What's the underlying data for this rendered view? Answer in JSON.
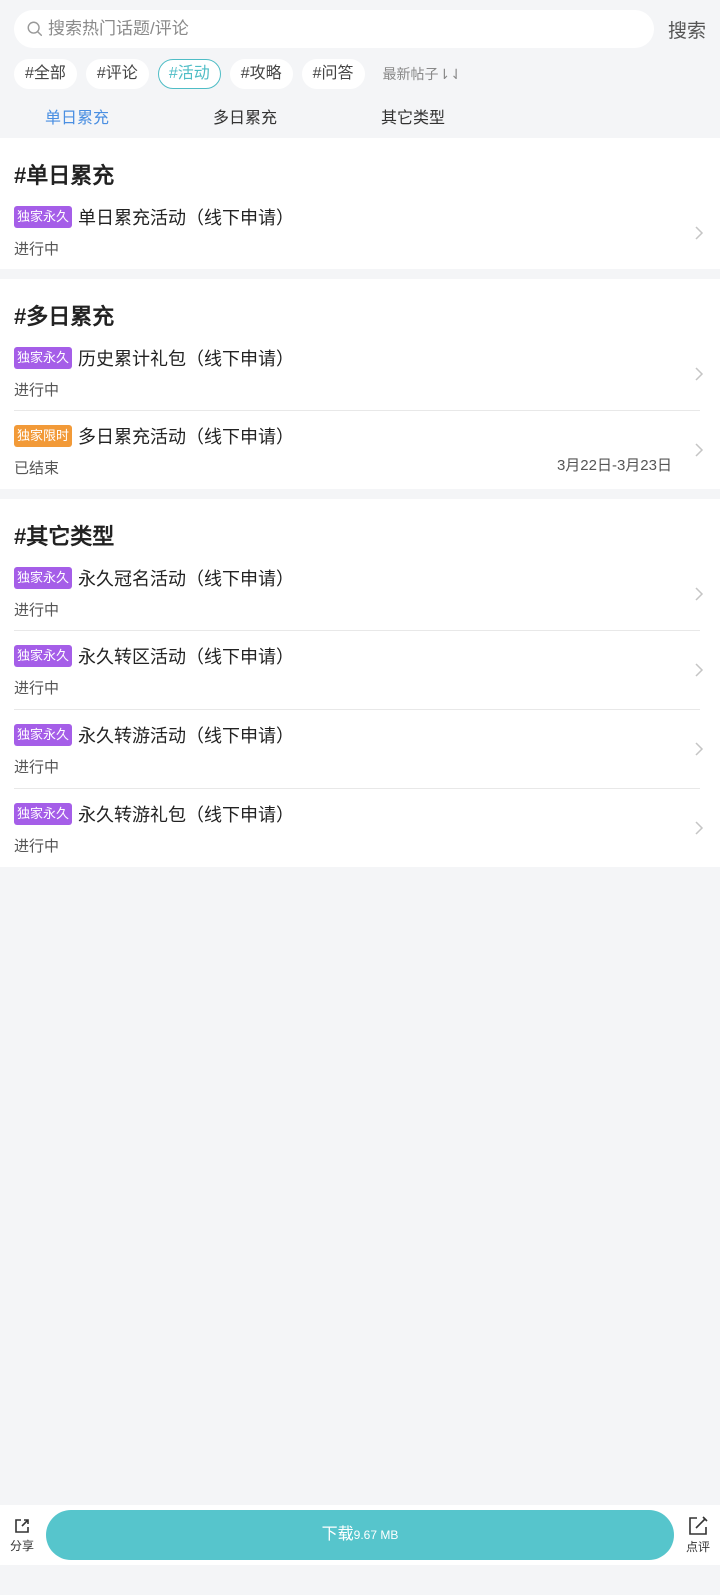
{
  "search": {
    "placeholder": "搜索热门话题/评论",
    "button": "搜索"
  },
  "chips": [
    "#全部",
    "#评论",
    "#活动",
    "#攻略",
    "#问答"
  ],
  "sort_label": "最新帖子⇂⇃",
  "subtabs": [
    "单日累充",
    "多日累充",
    "其它类型"
  ],
  "sections": [
    {
      "title": "#单日累充",
      "items": [
        {
          "badge": "独家永久",
          "title": "单日累充活动（线下申请）",
          "status": "进行中"
        }
      ]
    },
    {
      "title": "#多日累充",
      "items": [
        {
          "badge": "独家永久",
          "title": "历史累计礼包（线下申请）",
          "status": "进行中"
        },
        {
          "badge": "独家限时",
          "title": "多日累充活动（线下申请）",
          "status": "已结束",
          "date": "3月22日-3月23日"
        }
      ]
    },
    {
      "title": "#其它类型",
      "items": [
        {
          "badge": "独家永久",
          "title": "永久冠名活动（线下申请）",
          "status": "进行中"
        },
        {
          "badge": "独家永久",
          "title": "永久转区活动（线下申请）",
          "status": "进行中"
        },
        {
          "badge": "独家永久",
          "title": "永久转游活动（线下申请）",
          "status": "进行中"
        },
        {
          "badge": "独家永久",
          "title": "永久转游礼包（线下申请）",
          "status": "进行中"
        }
      ]
    }
  ],
  "bottom": {
    "share": "分享",
    "download_label": "下载",
    "download_size": "9.67 MB",
    "review": "点评"
  },
  "colors": {
    "accent": "#4fbdc6",
    "tab_active": "#4a8fe2",
    "badge_perm": "#a55ee8",
    "badge_limit": "#f29a38",
    "download_bg": "#56c5cc"
  }
}
